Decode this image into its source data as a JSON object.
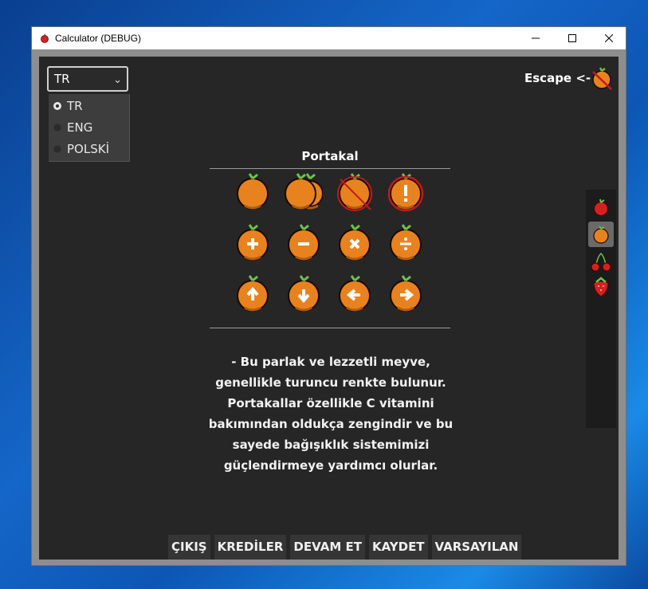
{
  "window": {
    "title": "Calculator (DEBUG)",
    "controls": [
      "minimize",
      "maximize",
      "close"
    ]
  },
  "language": {
    "selected": "TR",
    "options": [
      {
        "label": "TR",
        "checked": true
      },
      {
        "label": "ENG",
        "checked": false
      },
      {
        "label": "POLSKİ",
        "checked": false
      }
    ]
  },
  "escape": {
    "label": "Escape <-",
    "icon": "orange-crossed-icon"
  },
  "fruit": {
    "name": "Portakal",
    "icons": [
      [
        "orange-icon",
        "two-oranges-icon",
        "orange-crossed-icon",
        "orange-exclamation-icon"
      ],
      [
        "orange-plus-icon",
        "orange-minus-icon",
        "orange-times-icon",
        "orange-divide-icon"
      ],
      [
        "orange-up-arrow-icon",
        "orange-down-arrow-icon",
        "orange-left-arrow-icon",
        "orange-right-arrow-icon"
      ]
    ],
    "description": [
      "- Bu parlak ve lezzetli meyve,",
      "genellikle turuncu renkte bulunur.",
      "Portakallar özellikle C vitamini",
      "bakımından oldukça zengindir ve bu",
      "sayede bağışıklık sistemimizi",
      "güçlendirmeye yardımcı olurlar."
    ]
  },
  "sidebar": {
    "items": [
      "apple-icon",
      "orange-icon",
      "cherry-icon",
      "strawberry-icon"
    ],
    "selected": 1
  },
  "footer": {
    "buttons": [
      "ÇIKIŞ",
      "KREDİLER",
      "DEVAM ET",
      "KAYDET",
      "VARSAYILAN"
    ]
  },
  "colors": {
    "orange": "#e8821e",
    "dark_orange": "#b35a0c",
    "leaf": "#6cc24a",
    "background": "#262626",
    "red_cross": "#c41a1a"
  }
}
